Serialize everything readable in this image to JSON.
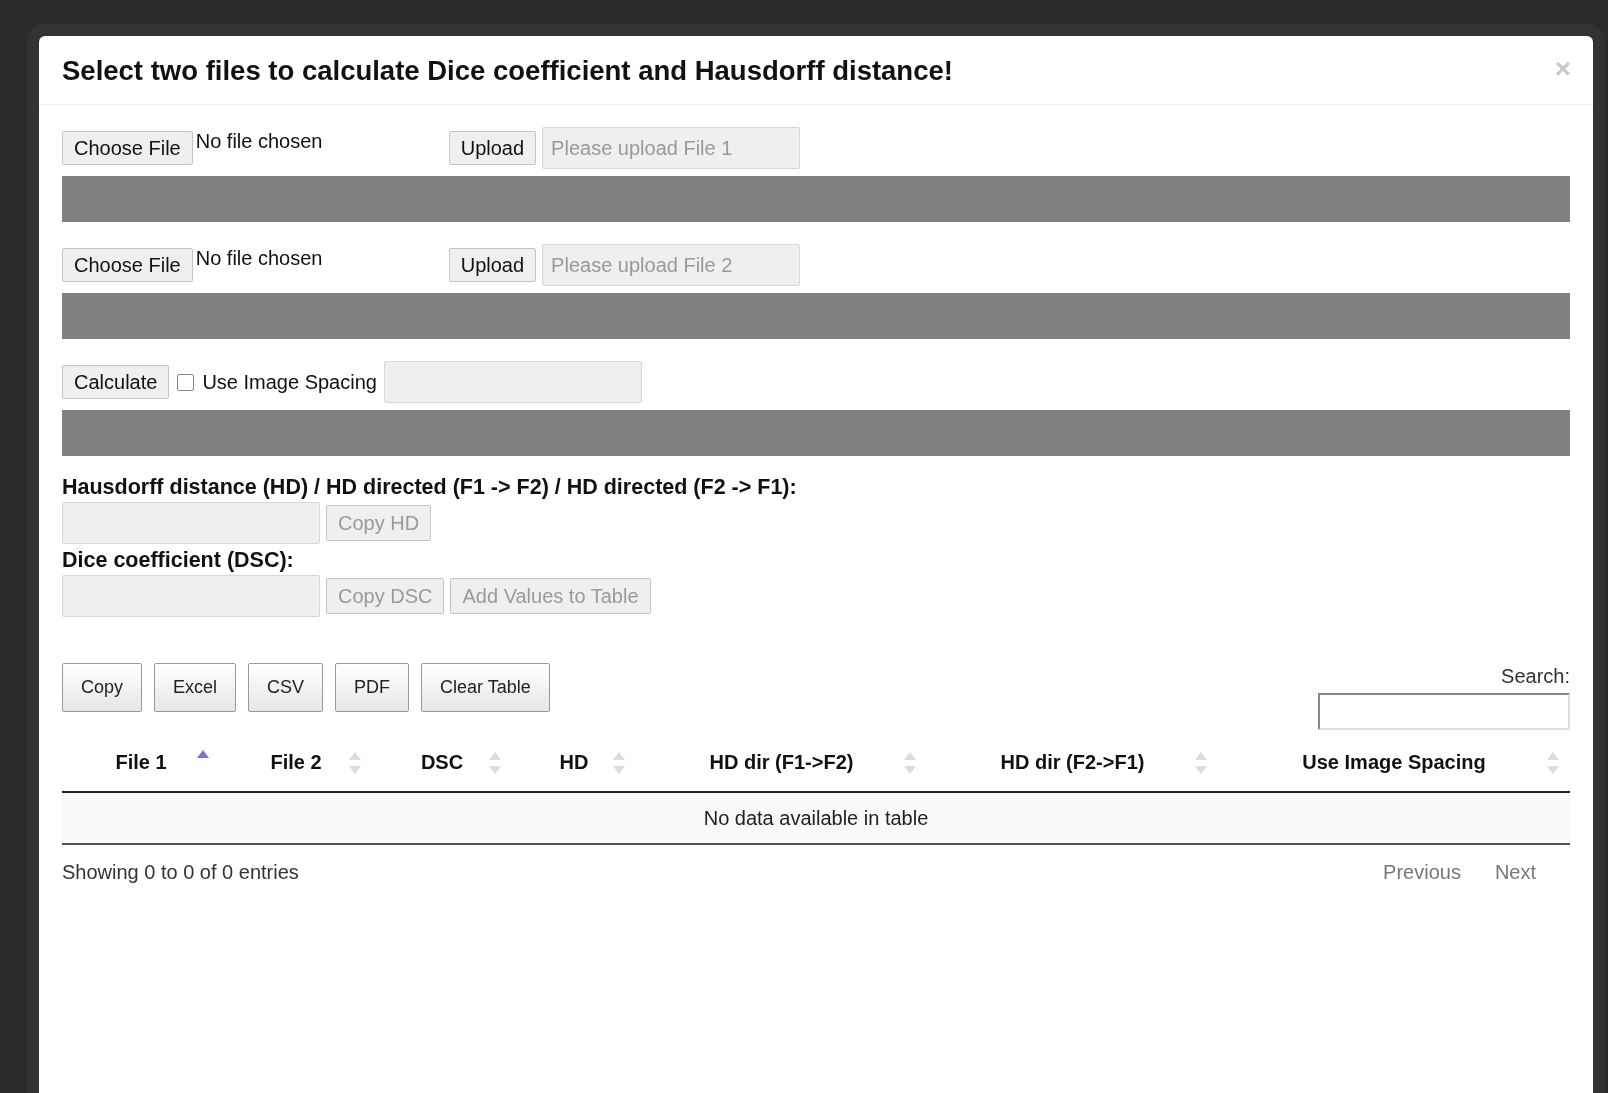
{
  "dialog": {
    "title": "Select two files to calculate Dice coefficient and Hausdorff distance!",
    "close": "×"
  },
  "uploads": [
    {
      "choose": "Choose File",
      "file_status": "No file chosen",
      "upload": "Upload",
      "placeholder": "Please upload File 1"
    },
    {
      "choose": "Choose File",
      "file_status": "No file chosen",
      "upload": "Upload",
      "placeholder": "Please upload File 2"
    }
  ],
  "calculate": {
    "button": "Calculate",
    "checkbox_label": "Use Image Spacing",
    "checked": false
  },
  "results": [
    {
      "label": "Hausdorff distance (HD) / HD directed (F1 -> F2) / HD directed (F2 -> F1):",
      "copy_button": {
        "label": "Copy HD",
        "disabled": true
      }
    },
    {
      "label": "Dice coefficient (DSC):",
      "copy_button": {
        "label": "Copy DSC",
        "disabled": true
      },
      "add_button": {
        "label": "Add Values to Table",
        "disabled": true
      }
    }
  ],
  "export_buttons": [
    "Copy",
    "Excel",
    "CSV",
    "PDF",
    "Clear Table"
  ],
  "search": {
    "label": "Search:"
  },
  "table": {
    "columns": [
      {
        "label": "File 1",
        "sorted_ascending": true
      },
      {
        "label": "File 2",
        "sorted_ascending": false
      },
      {
        "label": "DSC",
        "sorted_ascending": false
      },
      {
        "label": "HD",
        "sorted_ascending": false
      },
      {
        "label": "HD dir (F1->F2)",
        "sorted_ascending": false
      },
      {
        "label": "HD dir (F2->F1)",
        "sorted_ascending": false
      },
      {
        "label": "Use Image Spacing",
        "sorted_ascending": false
      }
    ],
    "empty_message": "No data available in table"
  },
  "footer": {
    "info": "Showing 0 to 0 of 0 entries",
    "pagination": [
      {
        "label": "Previous",
        "disabled": true
      },
      {
        "label": "Next",
        "disabled": true
      }
    ]
  }
}
